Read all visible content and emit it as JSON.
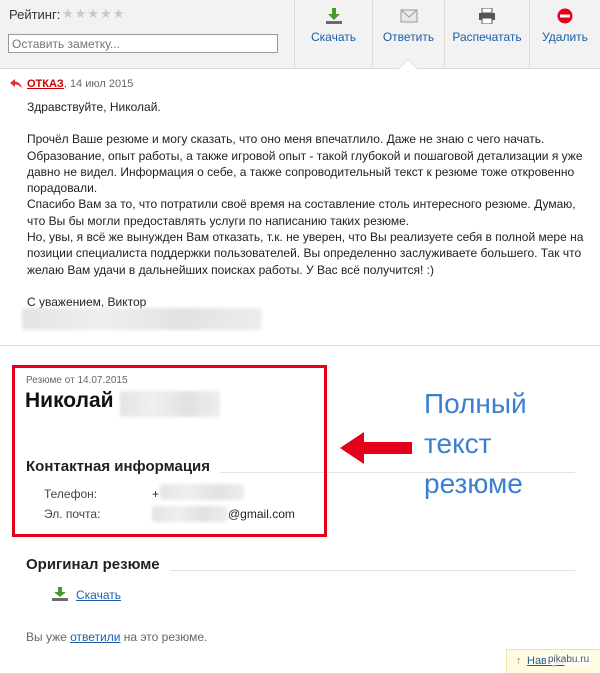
{
  "header": {
    "rating_label": "Рейтинг:",
    "stars": "★★★★★",
    "note_placeholder": "Оставить заметку..."
  },
  "toolbar": {
    "download": "Скачать",
    "reply": "Ответить",
    "print": "Распечатать",
    "delete": "Удалить"
  },
  "message": {
    "status": "ОТКАЗ",
    "date": ", 14 июл 2015",
    "greeting": "Здравствуйте, Николай.",
    "paragraph1": "Прочёл Ваше резюме и могу сказать, что оно меня впечатлило. Даже не знаю с чего начать. Образование, опыт работы, а также игровой опыт - такой глубокой и пошаговой детализации я уже давно не видел. Информация о себе, а также сопроводительный текст к резюме тоже откровенно порадовали.",
    "paragraph2": "Спасибо Вам за то, что потратили своё время на составление столь интересного резюме. Думаю, что Вы бы могли предоставлять услуги по написанию таких резюме.",
    "paragraph3": "Но, увы, я всё же вынужден Вам отказать, т.к. не уверен, что Вы реализуете себя в полной мере на позиции специалиста поддержки пользователей. Вы определенно заслуживаете большего. Так что желаю Вам удачи в дальнейших поисках работы. У Вас всё получится! :)",
    "signature": "С уважением, Виктор"
  },
  "resume": {
    "date": "Резюме от 14.07.2015",
    "name": "Николай",
    "contacts_title": "Контактная информация",
    "phone_label": "Телефон:",
    "phone_value": "+",
    "email_label": "Эл. почта:",
    "email_suffix": "@gmail.com"
  },
  "annotation": {
    "line1": "Полный",
    "line2": "текст",
    "line3": "резюме"
  },
  "original": {
    "title": "Оригинал резюме",
    "download": "Скачать"
  },
  "footer": {
    "replied_prefix": "Вы уже ",
    "replied_link": "ответили",
    "replied_suffix": " на это резюме.",
    "back_arrow": "↑",
    "back": "Наверх",
    "watermark": "pikabu.ru"
  },
  "colors": {
    "accent": "#1a5fa8",
    "status_red": "#cc0000",
    "annotation_blue": "#3c7fd1",
    "highlight_red": "#e4001a"
  }
}
